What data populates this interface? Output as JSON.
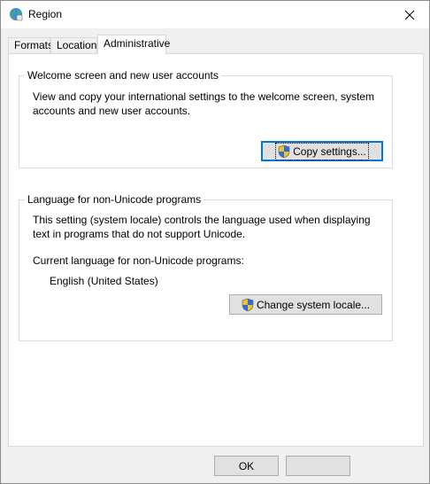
{
  "window": {
    "title": "Region",
    "close_glyph": "✕"
  },
  "tabs": [
    {
      "label": "Formats"
    },
    {
      "label": "Location"
    },
    {
      "label": "Administrative"
    }
  ],
  "welcome_group": {
    "legend": "Welcome screen and new user accounts",
    "description": "View and copy your international settings to the welcome screen, system accounts and new user accounts.",
    "copy_button_label": "Copy settings..."
  },
  "locale_group": {
    "legend": "Language for non-Unicode programs",
    "description": "This setting (system locale) controls the language used when displaying text in programs that do not support Unicode.",
    "current_label": "Current language for non-Unicode programs:",
    "current_value": "English (United States)",
    "change_button_label": "Change system locale..."
  },
  "footer": {
    "ok_label": "OK",
    "cancel_label": ""
  },
  "icons": {
    "app": "globe-icon",
    "shield": "uac-shield-icon",
    "close": "close-icon"
  },
  "colors": {
    "accent": "#0078d7",
    "panel": "#ffffff",
    "window_bg": "#f0f0f0"
  }
}
